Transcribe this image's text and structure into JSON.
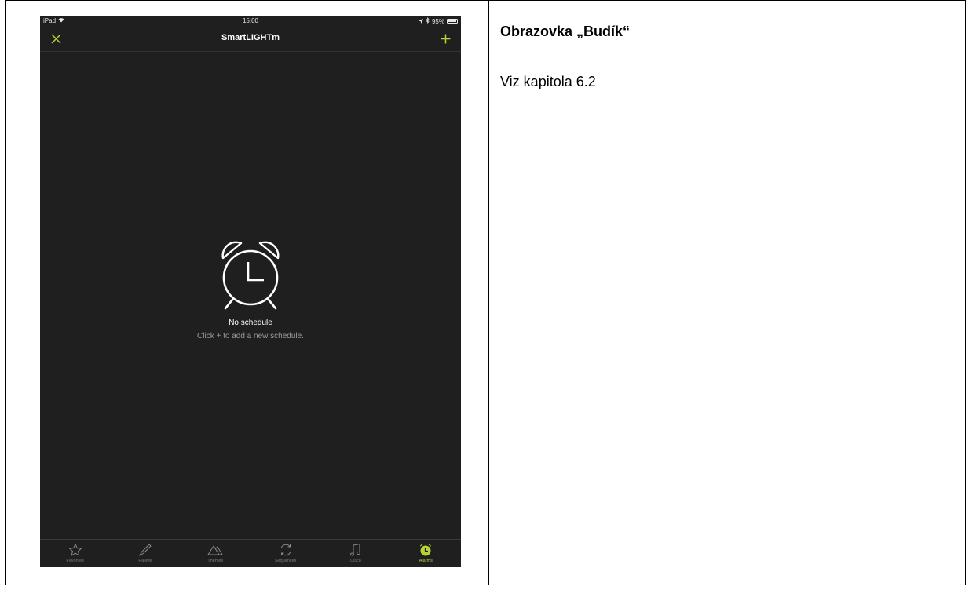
{
  "status_bar": {
    "device": "iPad",
    "time": "15:00",
    "battery": "95%"
  },
  "navbar": {
    "title": "SmartLIGHTm",
    "close_icon": "close-icon",
    "add_icon": "plus-icon"
  },
  "empty_state": {
    "icon": "alarm-clock-icon",
    "title": "No schedule",
    "subtitle": "Click + to add a new schedule."
  },
  "tabs": [
    {
      "label": "Favorites",
      "icon": "star-icon",
      "active": false
    },
    {
      "label": "Palette",
      "icon": "pipette-icon",
      "active": false
    },
    {
      "label": "Themes",
      "icon": "mountain-icon",
      "active": false
    },
    {
      "label": "Sequences",
      "icon": "refresh-icon",
      "active": false
    },
    {
      "label": "Disco",
      "icon": "music-note-icon",
      "active": false
    },
    {
      "label": "Alarms",
      "icon": "alarm-icon",
      "active": true
    }
  ],
  "colors": {
    "accent": "#b5d334",
    "device_bg": "#1f1f1f",
    "inactive": "#7a7a7a"
  },
  "document": {
    "heading": "Obrazovka „Budík“",
    "text": "Viz kapitola 6.2"
  }
}
